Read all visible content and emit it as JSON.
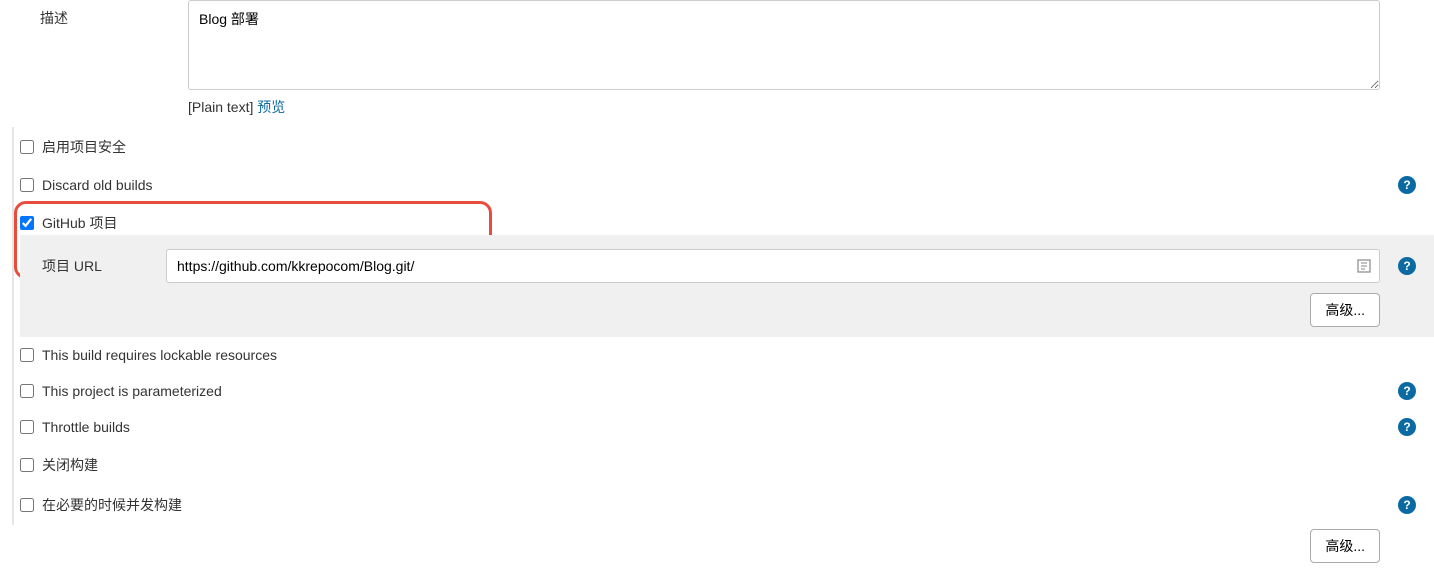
{
  "description": {
    "label": "描述",
    "value": "Blog 部署",
    "format_prefix": "[Plain text]",
    "preview_link": "预览"
  },
  "options": {
    "enable_security": {
      "label": "启用项目安全",
      "checked": false
    },
    "discard_old": {
      "label": "Discard old builds",
      "checked": false
    },
    "github_project": {
      "label": "GitHub 项目",
      "checked": true
    },
    "lockable": {
      "label": "This build requires lockable resources",
      "checked": false
    },
    "parameterized": {
      "label": "This project is parameterized",
      "checked": false
    },
    "throttle": {
      "label": "Throttle builds",
      "checked": false
    },
    "close_build": {
      "label": "关闭构建",
      "checked": false
    },
    "concurrent": {
      "label": "在必要的时候并发构建",
      "checked": false
    }
  },
  "github": {
    "url_label": "项目 URL",
    "url_value": "https://github.com/kkrepocom/Blog.git/"
  },
  "buttons": {
    "advanced": "高级..."
  },
  "help_glyph": "?"
}
